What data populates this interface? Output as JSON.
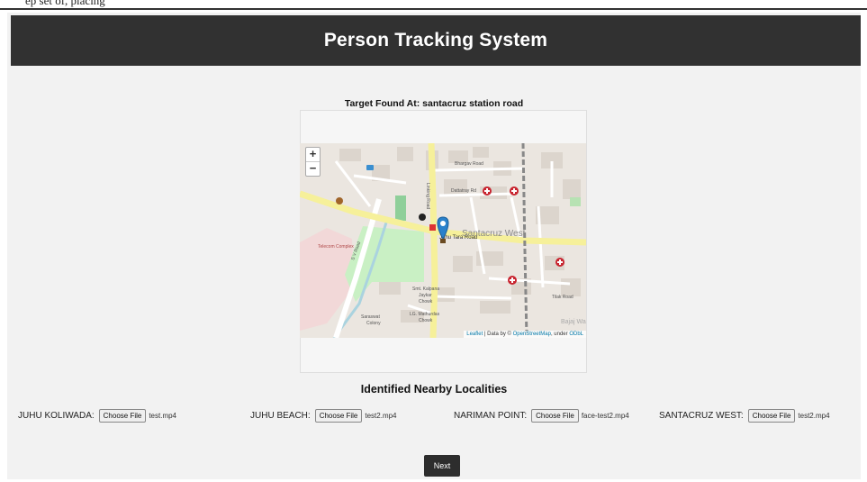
{
  "page": {
    "top_fragment": "ep   set of, placing",
    "header_title": "Person Tracking System",
    "target_label": "Target Found At: santacruz station road"
  },
  "map": {
    "zoom_in": "+",
    "zoom_out": "−",
    "labels": {
      "road_bhargav": "Bhargav Road",
      "road_dattatray": "Dattatray Rd",
      "road_linking": "Linking Road",
      "road_juhu_tara": "Juhu Tara Road",
      "road_sv": "S V Road",
      "road_tilak": "Tilak Road",
      "area_santacruz_west": "Santacruz West",
      "area_telecom": "Telecom Complex",
      "chowk_kalpana_1": "Smt. Kalpana",
      "chowk_kalpana_2": "Jaykar",
      "chowk_kalpana_3": "Chowk",
      "chowk_mathura_1": "LG. Mathurdas",
      "chowk_mathura_2": "Chowk",
      "colony_1": "Saraswat",
      "colony_2": "Colony",
      "bajaj": "Bajaj Wa"
    },
    "attribution_leaflet": "Leaflet",
    "attribution_mid": " | Data by © ",
    "attribution_osm": "OpenStreetMap",
    "attribution_under": ", under ",
    "attribution_odbl": "ODbL",
    "colors": {
      "marker": "#2a81cb",
      "poi": "#c8242f",
      "major_road": "#f6f09a",
      "park": "#c9f0c4"
    }
  },
  "nearby": {
    "title": "Identified Nearby Localities",
    "button_label": "Choose File",
    "items": [
      {
        "name": "JUHU KOLIWADA:",
        "file": "test.mp4"
      },
      {
        "name": "JUHU BEACH:",
        "file": "test2.mp4"
      },
      {
        "name": "NARIMAN POINT:",
        "file": "face-test2.mp4"
      },
      {
        "name": "SANTACRUZ WEST:",
        "file": "test2.mp4"
      }
    ]
  },
  "next_label": "Next"
}
